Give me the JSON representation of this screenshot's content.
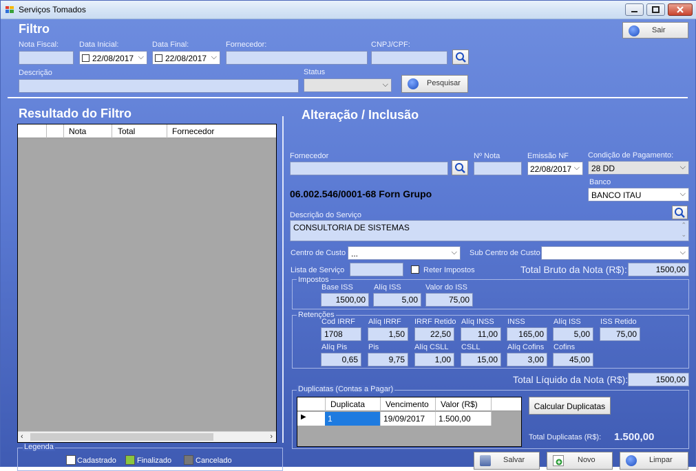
{
  "window": {
    "title": "Serviços Tomados"
  },
  "filtro": {
    "heading": "Filtro",
    "nota_fiscal_label": "Nota Fiscal:",
    "data_inicial_label": "Data Inicial:",
    "data_inicial_value": "22/08/2017",
    "data_final_label": "Data Final:",
    "data_final_value": "22/08/2017",
    "fornecedor_label": "Fornecedor:",
    "cnpj_label": "CNPJ/CPF:",
    "descricao_label": "Descrição",
    "status_label": "Status",
    "pesquisar_button": "Pesquisar",
    "sair_button": "Sair"
  },
  "resultado": {
    "heading": "Resultado do Filtro",
    "columns": [
      "Nota",
      "Total",
      "Fornecedor"
    ]
  },
  "legenda": {
    "label": "Legenda",
    "items": [
      {
        "label": "Cadastrado",
        "color": "#ffffff"
      },
      {
        "label": "Finalizado",
        "color": "#8bc63f"
      },
      {
        "label": "Cancelado",
        "color": "#777777"
      }
    ]
  },
  "alteracao": {
    "heading": "Alteração / Inclusão",
    "fornecedor_label": "Fornecedor",
    "nota_label": "Nº Nota",
    "emissao_label": "Emissão NF",
    "emissao_value": "22/08/2017",
    "condicao_label": "Condição de Pagamento:",
    "condicao_value": "28 DD",
    "banco_label": "Banco",
    "banco_value": "BANCO ITAU",
    "fornecedor_info": "06.002.546/0001-68  Forn Grupo",
    "descricao_servico_label": "Descrição do Serviço",
    "descricao_servico_value": "CONSULTORIA DE SISTEMAS",
    "centro_custo_label": "Centro de Custo",
    "centro_custo_value": "...",
    "sub_centro_label": "Sub Centro de Custo",
    "lista_servico_label": "Lista de Serviço",
    "reter_impostos_label": "Reter Impostos",
    "total_bruto_label": "Total Bruto da Nota (R$):",
    "total_bruto_value": "1500,00"
  },
  "impostos": {
    "label": "Impostos",
    "base_iss_label": "Base ISS",
    "base_iss_value": "1500,00",
    "aliq_iss_label": "Alíq ISS",
    "aliq_iss_value": "5,00",
    "valor_iss_label": "Valor do ISS",
    "valor_iss_value": "75,00"
  },
  "retencoes": {
    "label": "Retenções",
    "cod_irrf_label": "Cod IRRF",
    "cod_irrf_value": "1708",
    "aliq_irrf_label": "Alíq IRRF",
    "aliq_irrf_value": "1,50",
    "irrf_retido_label": "IRRF Retido",
    "irrf_retido_value": "22,50",
    "aliq_inss_label": "Alíq INSS",
    "aliq_inss_value": "11,00",
    "inss_label": "INSS",
    "inss_value": "165,00",
    "aliq_iss_label": "Alíq ISS",
    "aliq_iss_value": "5,00",
    "iss_retido_label": "ISS Retido",
    "iss_retido_value": "75,00",
    "aliq_pis_label": "Alíq Pis",
    "aliq_pis_value": "0,65",
    "pis_label": "Pis",
    "pis_value": "9,75",
    "aliq_csll_label": "Alíq CSLL",
    "aliq_csll_value": "1,00",
    "csll_label": "CSLL",
    "csll_value": "15,00",
    "aliq_cofins_label": "Alíq Cofins",
    "aliq_cofins_value": "3,00",
    "cofins_label": "Cofins",
    "cofins_value": "45,00"
  },
  "total_liquido": {
    "label": "Total Líquido da Nota (R$):",
    "value": "1500,00"
  },
  "duplicatas": {
    "label": "Duplicatas (Contas a Pagar)",
    "columns": [
      "Duplicata",
      "Vencimento",
      "Valor (R$)"
    ],
    "rows": [
      {
        "duplicata": "1",
        "vencimento": "19/09/2017",
        "valor": "1.500,00"
      }
    ],
    "calcular_button": "Calcular Duplicatas",
    "total_label": "Total Duplicatas (R$):",
    "total_value": "1.500,00"
  },
  "actions": {
    "salvar": "Salvar",
    "novo": "Novo",
    "limpar": "Limpar"
  }
}
